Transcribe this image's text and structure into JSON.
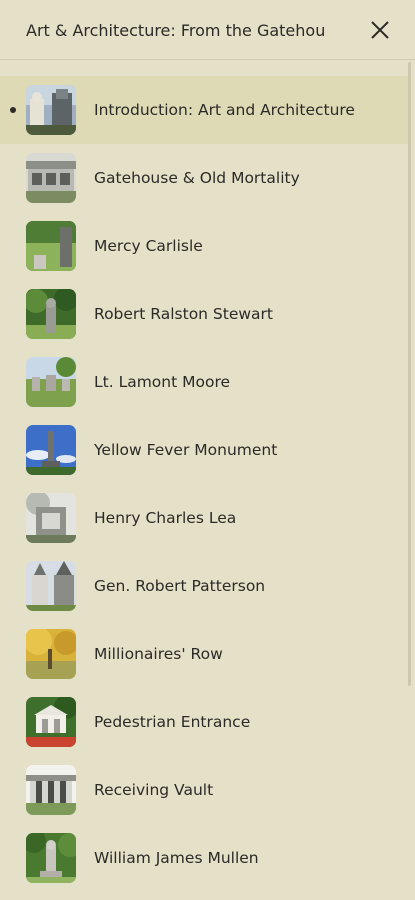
{
  "header": {
    "title": "Art & Architecture: From the Gatehou",
    "close_icon": "close-x-icon"
  },
  "stops": [
    {
      "label": "Introduction: Art and Architecture",
      "active": true,
      "thumb": "statue-monument"
    },
    {
      "label": "Gatehouse & Old Mortality",
      "active": false,
      "thumb": "gatehouse"
    },
    {
      "label": "Mercy Carlisle",
      "active": false,
      "thumb": "grave-lawn"
    },
    {
      "label": "Robert Ralston Stewart",
      "active": false,
      "thumb": "trees-statue"
    },
    {
      "label": "Lt. Lamont Moore",
      "active": false,
      "thumb": "headstones"
    },
    {
      "label": "Yellow Fever Monument",
      "active": false,
      "thumb": "obelisk-sky"
    },
    {
      "label": "Henry Charles Lea",
      "active": false,
      "thumb": "ornate-tomb"
    },
    {
      "label": "Gen. Robert Patterson",
      "active": false,
      "thumb": "gothic-monuments"
    },
    {
      "label": "Millionaires' Row",
      "active": false,
      "thumb": "autumn-trees"
    },
    {
      "label": "Pedestrian Entrance",
      "active": false,
      "thumb": "pavilion"
    },
    {
      "label": "Receiving Vault",
      "active": false,
      "thumb": "colonnade"
    },
    {
      "label": "William James Mullen",
      "active": false,
      "thumb": "statue-garden"
    }
  ]
}
